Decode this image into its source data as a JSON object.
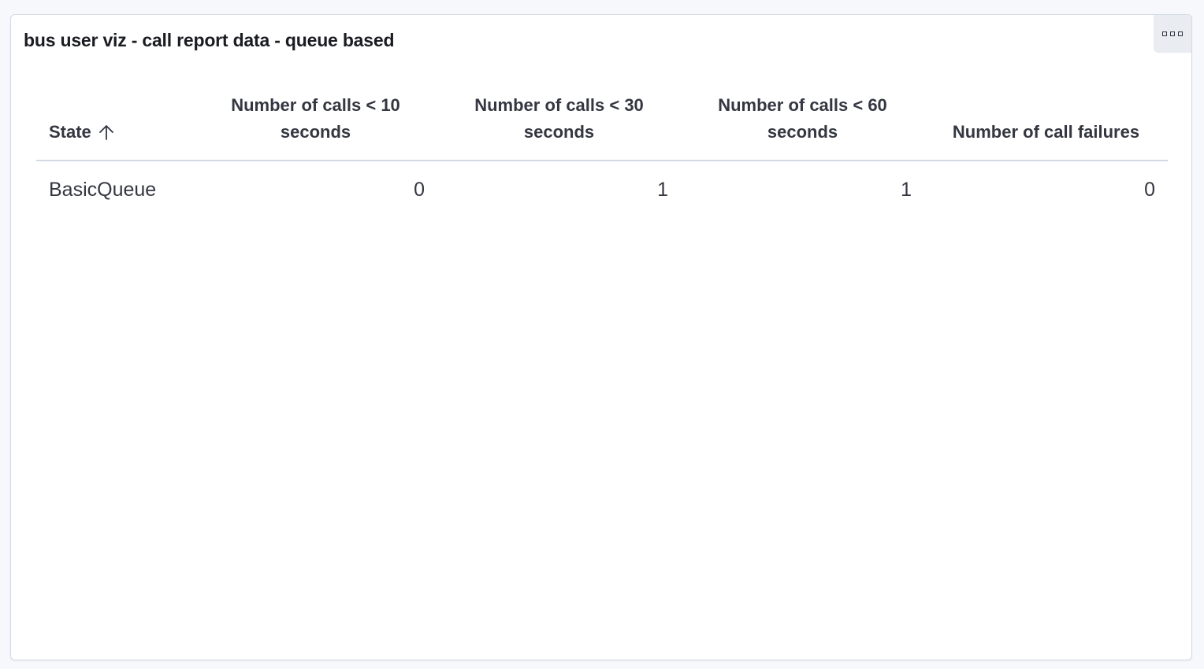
{
  "panel": {
    "title": "bus user viz - call report data - queue based",
    "menu_icon": "options-menu-icon"
  },
  "table": {
    "columns": [
      {
        "label": "State",
        "sort": "ascending",
        "sort_icon": "sort-ascending-arrow-icon"
      },
      {
        "label": "Number of calls < 10 seconds"
      },
      {
        "label": "Number of calls < 30 seconds"
      },
      {
        "label": "Number of calls < 60 seconds"
      },
      {
        "label": "Number of call failures"
      }
    ],
    "rows": [
      {
        "state": "BasicQueue",
        "calls_lt_10": "0",
        "calls_lt_30": "1",
        "calls_lt_60": "1",
        "failures": "0"
      }
    ]
  },
  "colors": {
    "text": "#343741",
    "title": "#1a1c21",
    "border": "#d3dae6",
    "background": "#f7f8fc"
  }
}
